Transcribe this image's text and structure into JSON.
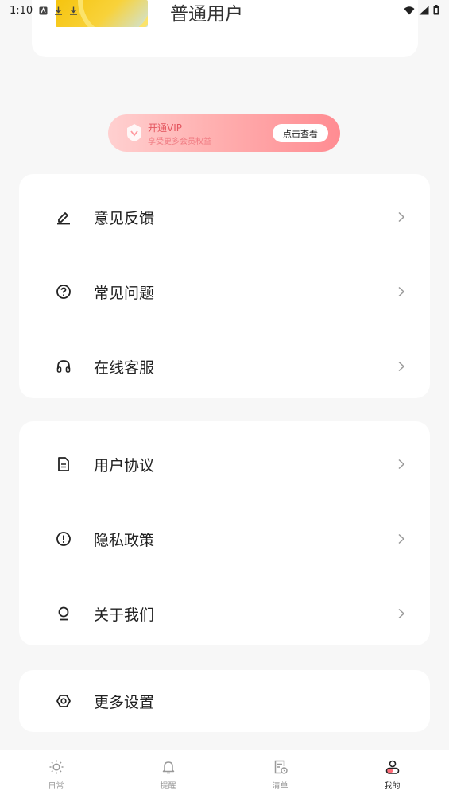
{
  "status_bar": {
    "time": "1:10"
  },
  "user": {
    "name": "普通用户"
  },
  "vip": {
    "title": "开通VIP",
    "subtitle": "享受更多会员权益",
    "button": "点击查看"
  },
  "menu_group_1": [
    {
      "label": "意见反馈",
      "icon": "pencil-icon"
    },
    {
      "label": "常见问题",
      "icon": "question-icon"
    },
    {
      "label": "在线客服",
      "icon": "headset-icon"
    }
  ],
  "menu_group_2": [
    {
      "label": "用户协议",
      "icon": "document-icon"
    },
    {
      "label": "隐私政策",
      "icon": "info-icon"
    },
    {
      "label": "关于我们",
      "icon": "bulb-icon"
    }
  ],
  "menu_group_3": [
    {
      "label": "更多设置",
      "icon": "settings-icon"
    }
  ],
  "bottom_nav": [
    {
      "label": "日常",
      "icon": "sun-icon",
      "active": false
    },
    {
      "label": "提醒",
      "icon": "bell-icon",
      "active": false
    },
    {
      "label": "清单",
      "icon": "list-clock-icon",
      "active": false
    },
    {
      "label": "我的",
      "icon": "profile-icon",
      "active": true
    }
  ],
  "colors": {
    "accent": "#ff8c92",
    "vip_text": "#e4565f",
    "background": "#f7f7f7"
  }
}
